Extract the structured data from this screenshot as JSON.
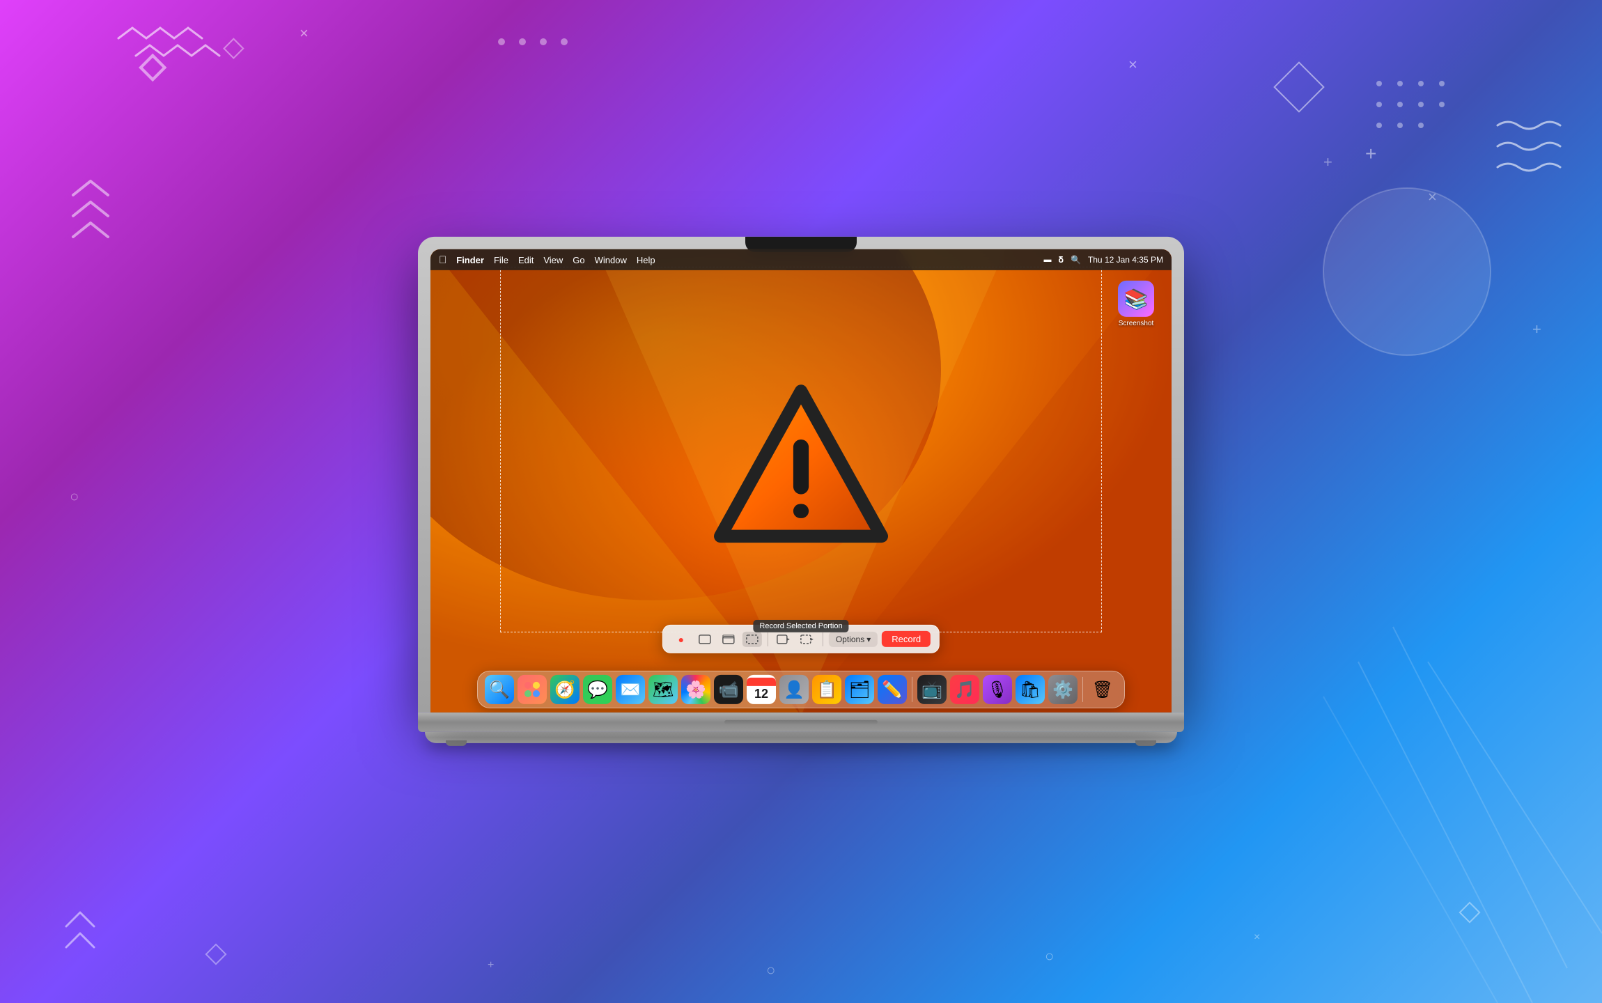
{
  "background": {
    "gradient": "linear-gradient(135deg, #e040fb 0%, #9c27b0 20%, #7c4dff 40%, #3f51b5 60%, #2196f3 80%, #64b5f6 100%)"
  },
  "menubar": {
    "apple": "⌘",
    "items": [
      "Finder",
      "File",
      "Edit",
      "View",
      "Go",
      "Window",
      "Help"
    ],
    "right_items": [
      "Thu 12 Jan  4:35 PM"
    ]
  },
  "tooltip": {
    "text": "Record Selected Portion"
  },
  "toolbar": {
    "options_label": "Options",
    "options_arrow": "▾",
    "record_label": "Record"
  },
  "desktop": {
    "icon_label": "Screenshot"
  },
  "dock": {
    "icons": [
      {
        "name": "Finder",
        "emoji": "🔍",
        "class": "dock-finder"
      },
      {
        "name": "Launchpad",
        "emoji": "🚀",
        "class": "dock-launchpad"
      },
      {
        "name": "Safari",
        "emoji": "🧭",
        "class": "dock-safari"
      },
      {
        "name": "Messages",
        "emoji": "💬",
        "class": "dock-messages"
      },
      {
        "name": "Mail",
        "emoji": "✉️",
        "class": "dock-mail"
      },
      {
        "name": "Maps",
        "emoji": "🗺",
        "class": "dock-maps"
      },
      {
        "name": "Photos",
        "emoji": "🖼",
        "class": "dock-photos"
      },
      {
        "name": "FaceTime",
        "emoji": "📹",
        "class": "dock-facetime"
      },
      {
        "name": "Calendar",
        "emoji": "📅",
        "class": "dock-calendar"
      },
      {
        "name": "Contacts",
        "emoji": "👤",
        "class": "dock-contacts"
      },
      {
        "name": "Reminders",
        "emoji": "📋",
        "class": "dock-reminders"
      },
      {
        "name": "Files",
        "emoji": "🗂",
        "class": "dock-files"
      },
      {
        "name": "Freeform",
        "emoji": "✏️",
        "class": "dock-freeform"
      },
      {
        "name": "Apple TV",
        "emoji": "📺",
        "class": "dock-appletv"
      },
      {
        "name": "Music",
        "emoji": "🎵",
        "class": "dock-music"
      },
      {
        "name": "Podcasts",
        "emoji": "🎙",
        "class": "dock-podcasts"
      },
      {
        "name": "App Store",
        "emoji": "🛍",
        "class": "dock-appstore"
      },
      {
        "name": "System Settings",
        "emoji": "⚙️",
        "class": "dock-settings"
      },
      {
        "name": "Bin",
        "emoji": "🗑",
        "class": "dock-bin"
      }
    ]
  }
}
